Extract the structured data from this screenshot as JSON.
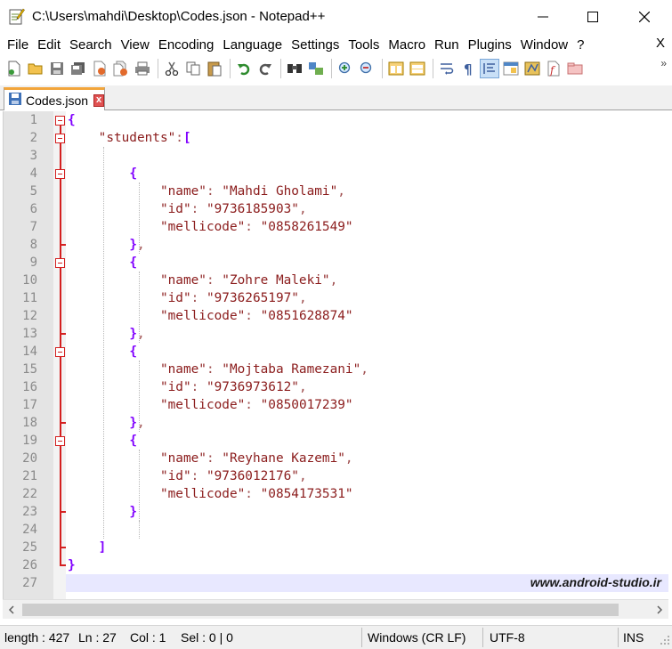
{
  "window": {
    "title": "C:\\Users\\mahdi\\Desktop\\Codes.json - Notepad++"
  },
  "menu": {
    "items": [
      "File",
      "Edit",
      "Search",
      "View",
      "Encoding",
      "Language",
      "Settings",
      "Tools",
      "Macro",
      "Run",
      "Plugins",
      "Window",
      "?"
    ],
    "close_glyph": "X"
  },
  "toolbar": {
    "overflow_glyph": "»",
    "buttons": [
      "new-file-icon",
      "open-file-icon",
      "save-icon",
      "save-all-icon",
      "close-icon",
      "close-all-icon",
      "print-icon",
      "cut-icon",
      "copy-icon",
      "paste-icon",
      "undo-icon",
      "redo-icon",
      "find-icon",
      "replace-icon",
      "zoom-in-icon",
      "zoom-out-icon",
      "sync-vertical-icon",
      "sync-horizontal-icon",
      "word-wrap-icon",
      "show-all-chars-icon",
      "indent-guide-icon",
      "doc-map-icon",
      "function-list-icon",
      "folder-workspace-icon",
      "macro-record-icon"
    ]
  },
  "tab": {
    "label": "Codes.json",
    "close_glyph": "x"
  },
  "editor": {
    "lines": [
      {
        "n": "1",
        "text": "{"
      },
      {
        "n": "2",
        "text": "    \"students\":["
      },
      {
        "n": "3",
        "text": ""
      },
      {
        "n": "4",
        "text": "        {"
      },
      {
        "n": "5",
        "text": "            \"name\": \"Mahdi Gholami\","
      },
      {
        "n": "6",
        "text": "            \"id\": \"9736185903\","
      },
      {
        "n": "7",
        "text": "            \"mellicode\": \"0858261549\""
      },
      {
        "n": "8",
        "text": "        },"
      },
      {
        "n": "9",
        "text": "        {"
      },
      {
        "n": "10",
        "text": "            \"name\": \"Zohre Maleki\","
      },
      {
        "n": "11",
        "text": "            \"id\": \"9736265197\","
      },
      {
        "n": "12",
        "text": "            \"mellicode\": \"0851628874\""
      },
      {
        "n": "13",
        "text": "        },"
      },
      {
        "n": "14",
        "text": "        {"
      },
      {
        "n": "15",
        "text": "            \"name\": \"Mojtaba Ramezani\","
      },
      {
        "n": "16",
        "text": "            \"id\": \"9736973612\","
      },
      {
        "n": "17",
        "text": "            \"mellicode\": \"0850017239\""
      },
      {
        "n": "18",
        "text": "        },"
      },
      {
        "n": "19",
        "text": "        {"
      },
      {
        "n": "20",
        "text": "            \"name\": \"Reyhane Kazemi\","
      },
      {
        "n": "21",
        "text": "            \"id\": \"9736012176\","
      },
      {
        "n": "22",
        "text": "            \"mellicode\": \"0854173531\""
      },
      {
        "n": "23",
        "text": "        }"
      },
      {
        "n": "24",
        "text": ""
      },
      {
        "n": "25",
        "text": "    ]"
      },
      {
        "n": "26",
        "text": "}"
      },
      {
        "n": "27",
        "text": ""
      }
    ],
    "fold_lines": [
      "1",
      "2",
      "4",
      "9",
      "14",
      "19"
    ],
    "watermark": "www.android-studio.ir"
  },
  "statusbar": {
    "length": "length : 427",
    "line": "Ln : 27",
    "col": "Col : 1",
    "sel": "Sel : 0 | 0",
    "eol": "Windows (CR LF)",
    "encoding": "UTF-8",
    "mode": "INS"
  },
  "colors": {
    "brace": "#8000ff",
    "string": "#8b1c1c",
    "fold": "#d42020",
    "tab_accent": "#f2a53b",
    "current_line": "#e8e8ff"
  }
}
